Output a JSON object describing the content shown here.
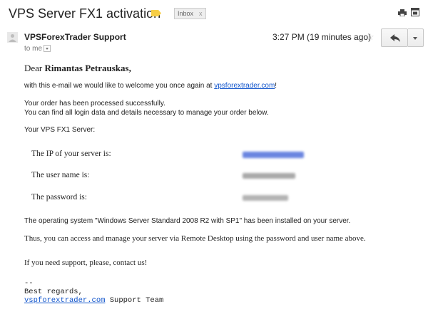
{
  "subject": "VPS Server FX1 activation",
  "label_chip": "Inbox",
  "label_chip_close": "x",
  "sender": "VPSForexTrader Support",
  "to_me": "to me",
  "time": "3:27 PM (19 minutes ago)",
  "colors": {
    "label_tag": "#f7ce46",
    "link": "#1155cc"
  },
  "icons": [
    "print-icon",
    "new-window-icon",
    "avatar-icon",
    "star-icon",
    "reply-icon",
    "chevron-down-icon"
  ],
  "message": {
    "greeting_prefix": "Dear",
    "recipient_name": "Rimantas Petrauskas,",
    "welcome_prefix": "with this e-mail we would like to welcome you once again at",
    "welcome_link": "vpsforextrader.com",
    "welcome_suffix": "!",
    "order_line1": "Your order has been processed successfully.",
    "order_line2": "You can find all login data and details necessary to manage your order below.",
    "server_heading": "Your VPS FX1 Server:",
    "ip_label": "The IP of your server is:",
    "user_label": "The user name is:",
    "password_label": "The password is:",
    "os_line": "The operating system \"Windows Server Standard 2008 R2 with SP1\" has been installed on your server.",
    "access_line": "Thus, you can access and manage your server via Remote Desktop using the password and user name above.",
    "support_line": "If you need support, please, contact us!",
    "sig_dash": "--",
    "sig_regards": "Best regards,",
    "sig_link": "vspforextrader.com",
    "sig_team": " Support Team"
  }
}
